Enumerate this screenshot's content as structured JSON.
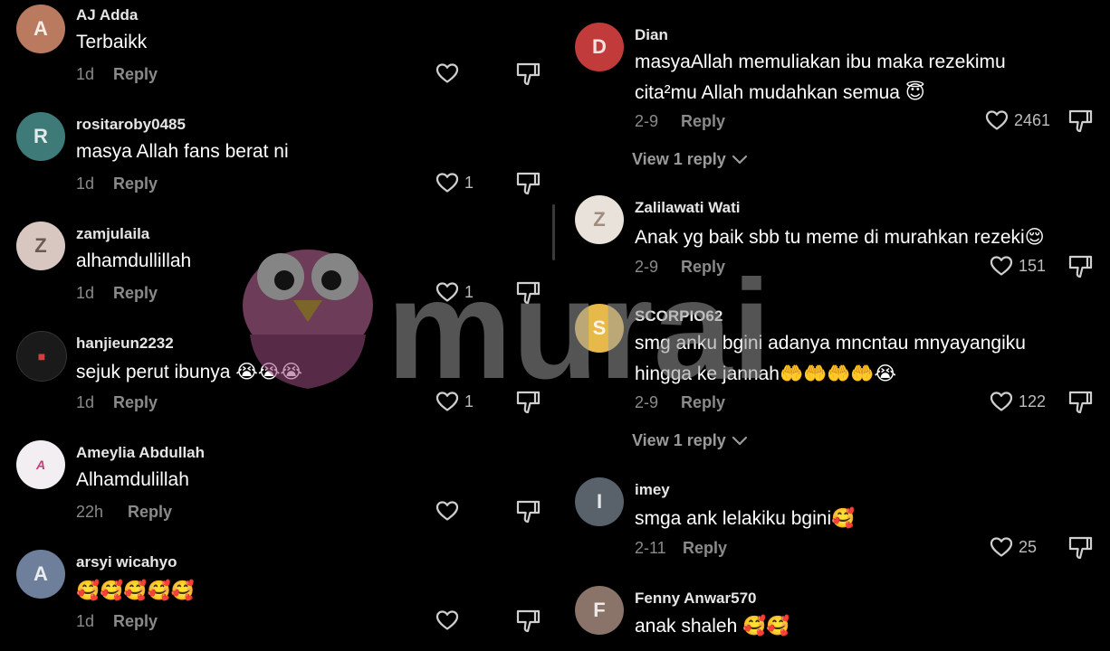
{
  "left_comments": [
    {
      "username": "AJ Adda",
      "text": "Terbaikk",
      "time": "1d",
      "reply": "Reply",
      "likes": "",
      "avatar_color": "#b97a5f"
    },
    {
      "username": "rositaroby0485",
      "text": "masya Allah fans berat ni",
      "time": "1d",
      "reply": "Reply",
      "likes": "1",
      "avatar_color": "#3e7a78"
    },
    {
      "username": "zamjulaila",
      "text": "alhamdullillah",
      "time": "1d",
      "reply": "Reply",
      "likes": "1",
      "avatar_color": "#d7c7c0"
    },
    {
      "username": "hanjieun2232",
      "text": "sejuk perut ibunya 😭😭😭",
      "time": "1d",
      "reply": "Reply",
      "likes": "1",
      "avatar_color": "#b02222"
    },
    {
      "username": "Ameylia Abdullah",
      "text": "Alhamdulillah",
      "time": "22h",
      "reply": "Reply",
      "likes": "",
      "avatar_color": "#f2eef2"
    },
    {
      "username": "arsyi wicahyo",
      "text": "🥰🥰🥰🥰🥰",
      "time": "1d",
      "reply": "Reply",
      "likes": "",
      "avatar_color": "#6d7f9a"
    }
  ],
  "right_comments": [
    {
      "username": "Dian",
      "text_lines": [
        "masyaAllah memuliakan ibu maka rezekimu",
        "cita²mu Allah mudahkan semua 😇"
      ],
      "time": "2-9",
      "reply": "Reply",
      "likes": "2461",
      "avatar_color": "#c23b3b",
      "view_replies": "View 1 reply"
    },
    {
      "username": "Zalilawati Wati",
      "text_lines": [
        "Anak yg baik sbb tu meme di murahkan rezeki😌"
      ],
      "time": "2-9",
      "reply": "Reply",
      "likes": "151",
      "avatar_color": "#e8e2da",
      "view_replies": ""
    },
    {
      "username": "SCORPIO62",
      "text_lines": [
        "smg anku bgini adanya mncntau mnyayangiku",
        "hingga ke jannah🤲🤲🤲🤲😭"
      ],
      "time": "2-9",
      "reply": "Reply",
      "likes": "122",
      "avatar_color": "#e7b84a",
      "view_replies": "View 1 reply"
    },
    {
      "username": "imey",
      "text_lines": [
        "smga ank lelakiku bgini🥰"
      ],
      "time": "2-11",
      "reply": "Reply",
      "likes": "25",
      "avatar_color": "#59626b",
      "view_replies": ""
    },
    {
      "username": "Fenny Anwar570",
      "text_lines": [
        "anak shaleh 🥰🥰"
      ],
      "time": "",
      "reply": "",
      "likes": "",
      "avatar_color": "#8a7368",
      "view_replies": ""
    }
  ],
  "watermark": {
    "text": "murai"
  },
  "icons": {
    "like": "heart-outline-icon",
    "dislike": "thumbs-down-icon",
    "chevron": "chevron-down-icon"
  }
}
